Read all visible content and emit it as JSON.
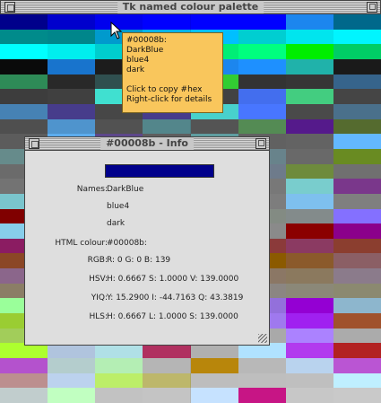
{
  "main_window": {
    "title": "Tk named colour palette"
  },
  "tooltip": {
    "lines": [
      "#00008b:",
      "DarkBlue",
      "blue4",
      "dark",
      "",
      "Click to copy #hex",
      "Right-click for details"
    ]
  },
  "info_window": {
    "title": "#00008b - Info",
    "swatch_color": "#00008b",
    "names_label": "Names:",
    "names": [
      "DarkBlue",
      "blue4",
      "dark"
    ],
    "html_label": "HTML colour:",
    "html_value": "#00008b:",
    "rgb_label": "RGB:",
    "rgb_value": "R: 0  G: 0  B: 139",
    "hsv_label": "HSV:",
    "hsv_value": "H: 0.6667  S: 1.0000  V: 139.0000",
    "yiq_label": "YIQ:",
    "yiq_value": "Y: 15.2900  I: -44.7163  Q: 43.3819",
    "hls_label": "HLS:",
    "hls_value": "H: 0.6667  L: 1.0000  S: 139.0000"
  },
  "palette": {
    "rows": [
      [
        "#00008b",
        "#0000cd",
        "#0000ee",
        "#0000ff",
        "#0000ff",
        "#0000ff",
        "#1c86ee",
        "#00688b",
        "#008b8b",
        "#00c5cd"
      ],
      [
        "#008b8b",
        "#00868b",
        "#009acd",
        "#00b2ee",
        "#00bfff",
        "#00ced1",
        "#00e5ee",
        "#00f5ff",
        "#00fa9a",
        "#00cd00"
      ],
      [
        "#00ffff",
        "#00eeee",
        "#00cdcd",
        "#008b00",
        "#00ee76",
        "#00ff7f",
        "#00ee00",
        "#00cd66",
        "#00ff00",
        "#00ff00"
      ],
      [
        "#0a0a0a",
        "#1874cd",
        "#1c1c1c",
        "#191970",
        "#1c86ee",
        "#1e90ff",
        "#20b2aa",
        "#1a1a1a",
        "#262626",
        "#228b22"
      ],
      [
        "#2e8b57",
        "#292929",
        "#2f4f4f",
        "#303030",
        "#32cd32",
        "#333333",
        "#363636",
        "#36648b",
        "#3a5fcd",
        "#3cb371"
      ],
      [
        "#3d3d3d",
        "#404040",
        "#40e0d0",
        "#4169e1",
        "#424242",
        "#436eee",
        "#43cd80",
        "#454545",
        "#458b00",
        "#458b74"
      ],
      [
        "#4682b4",
        "#473c8b",
        "#474747",
        "#483d8b",
        "#48d1cc",
        "#4876ff",
        "#4a4a4a",
        "#4a708b",
        "#4d4d4d",
        "#4eee94"
      ],
      [
        "#4f4f4f",
        "#4f94cd",
        "#525252",
        "#53868b",
        "#545454",
        "#548b54",
        "#551a8b",
        "#556b2f",
        "#575757",
        "#595959"
      ],
      [
        "#5c5c5c",
        "#5cacee",
        "#5d478b",
        "#5e5e5e",
        "#5f9ea0",
        "#616161",
        "#636363",
        "#63b8ff",
        "#6495ed",
        "#666666"
      ],
      [
        "#668b8b",
        "#66cd00",
        "#66cdaa",
        "#68228b",
        "#683c8b",
        "#68838b",
        "#696969",
        "#698b22",
        "#698b69",
        "#6a5acd"
      ],
      [
        "#6b6b6b",
        "#6b8e23",
        "#6c7b8b",
        "#6ca6cd",
        "#6e6e6e",
        "#6e7b8b",
        "#6e8b3d",
        "#707070",
        "#708090",
        "#7171c6"
      ],
      [
        "#737373",
        "#757575",
        "#76ee00",
        "#76eec6",
        "#778899",
        "#787878",
        "#79cdcd",
        "#7a378b",
        "#7a67ee",
        "#7a7a7a"
      ],
      [
        "#7ac5cd",
        "#7b68ee",
        "#7ccd7c",
        "#7cfc00",
        "#7d26cd",
        "#7d7d7d",
        "#7ec0ee",
        "#7f7f7f",
        "#7fff00",
        "#7fffd4"
      ],
      [
        "#800000",
        "#808000",
        "#808080",
        "#828282",
        "#836fff",
        "#838b83",
        "#838b8b",
        "#8470ff",
        "#858585",
        "#878787"
      ],
      [
        "#87ceeb",
        "#87cefa",
        "#87ceff",
        "#8968cd",
        "#8a2be2",
        "#8a8a8a",
        "#8b0000",
        "#8b008b",
        "#8b0a50",
        "#8b1a1a"
      ],
      [
        "#8b1c62",
        "#8b2252",
        "#8b2323",
        "#8b2500",
        "#8b3626",
        "#8b3a3a",
        "#8b3a62",
        "#8b3e2f",
        "#8b4500",
        "#8b4513"
      ],
      [
        "#8b4726",
        "#8b475d",
        "#8b4789",
        "#8b4c39",
        "#8b5742",
        "#8b5a00",
        "#8b5a2b",
        "#8b5f65",
        "#8b636c",
        "#8b6508"
      ],
      [
        "#8b668b",
        "#8b6914",
        "#8b6969",
        "#8b7355",
        "#8b7500",
        "#8b7765",
        "#8b795e",
        "#8b7b8b",
        "#8b7d6b",
        "#8b7d7b"
      ],
      [
        "#8b7e66",
        "#8b814c",
        "#8b8378",
        "#8b8386",
        "#8b864e",
        "#8b8682",
        "#8b8878",
        "#8b8970",
        "#8b8989",
        "#8b8b00"
      ],
      [
        "#9aff9a",
        "#90ee90",
        "#8deeee",
        "#8fbc8f",
        "#8ee5ee",
        "#9370db",
        "#9400d3",
        "#8db6cd",
        "#9932cc",
        "#9a32cd"
      ],
      [
        "#9acd32",
        "#9b30ff",
        "#9bcd9b",
        "#9c9c9c",
        "#9e9e9e",
        "#9f79ee",
        "#a020f0",
        "#a0522d",
        "#a1a1a1",
        "#a2b5cd"
      ],
      [
        "#a2cd5a",
        "#a3a3a3",
        "#a4d3ee",
        "#a52a2a",
        "#a6a6a6",
        "#a9a9a9",
        "#ab82ff",
        "#abababab",
        "#adadad",
        "#add8e6"
      ],
      [
        "#adff2f",
        "#b0c4de",
        "#b0e0e6",
        "#b03060",
        "#b0b0b0",
        "#b0e2ff",
        "#b23aee",
        "#b22222",
        "#b3b3b3",
        "#b3ee3a"
      ],
      [
        "#b452cd",
        "#b4cdcd",
        "#b4eeb4",
        "#b5b5b5",
        "#b8860b",
        "#b8b8b8",
        "#b9d3ee",
        "#ba55d3",
        "#bababa",
        "#bbffff"
      ],
      [
        "#bc8f8f",
        "#bcd2ee",
        "#bcee68",
        "#bdb76b",
        "#bdbdbd",
        "#bebebe",
        "#bfbfbf",
        "#bfefff",
        "#c0ff3e",
        "#c1cdc1"
      ],
      [
        "#c1cdcd",
        "#c1ffc1",
        "#c2c2c2",
        "#c4c4c4",
        "#c6e2ff",
        "#c71585",
        "#c7c7c7",
        "#c9c9c9",
        "#cae1ff",
        "#caff70"
      ]
    ]
  }
}
